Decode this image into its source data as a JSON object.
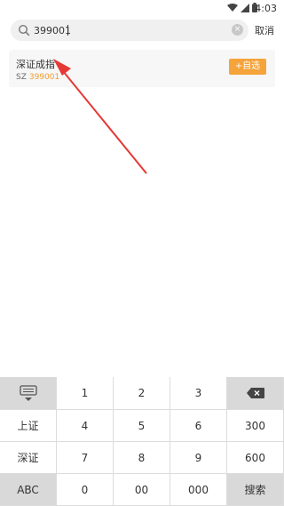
{
  "status_bar": {
    "time": "4:03",
    "icons": [
      "wifi-icon",
      "signal-icon",
      "battery-icon"
    ]
  },
  "search": {
    "query": "399001",
    "clear_icon": "clear-icon",
    "cancel_label": "取消"
  },
  "result": {
    "name": "深证成指",
    "market": "SZ",
    "code": "399001",
    "add_button_label": "+自选"
  },
  "keyboard": {
    "hide_icon": "keyboard-hide-icon",
    "backspace_icon": "backspace-icon",
    "rows": [
      [
        "",
        "1",
        "2",
        "3",
        ""
      ],
      [
        "上证",
        "4",
        "5",
        "6",
        "300"
      ],
      [
        "深证",
        "7",
        "8",
        "9",
        "600"
      ],
      [
        "ABC",
        "0",
        "00",
        "000",
        "搜索"
      ]
    ]
  },
  "colors": {
    "accent": "#f5a33b",
    "code_text": "#f09b2b",
    "arrow": "#e53935"
  }
}
